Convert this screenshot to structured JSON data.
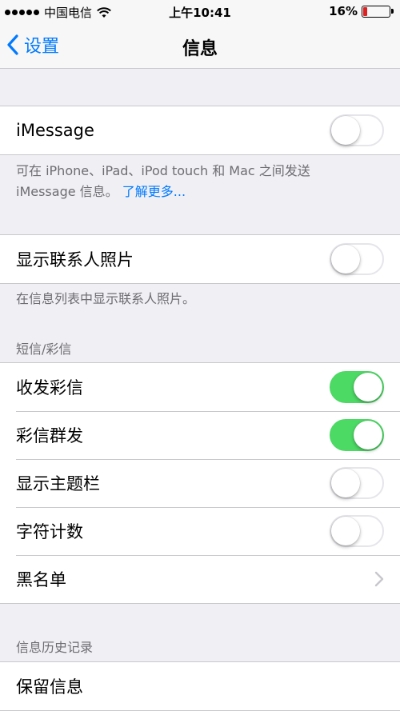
{
  "status_bar": {
    "carrier": "中国电信",
    "time": "上午10:41",
    "battery_percent": "16%",
    "battery_level": 0.16,
    "battery_color": "#e02020",
    "wifi_icon": "wifi-icon"
  },
  "nav": {
    "back_label": "设置",
    "back_icon": "chevron-left-icon",
    "title": "信息"
  },
  "imessage": {
    "label": "iMessage",
    "enabled": false,
    "footer_text": "可在 iPhone、iPad、iPod touch 和 Mac 之间发送 iMessage 信息。",
    "footer_link": "了解更多..."
  },
  "contact_photos": {
    "label": "显示联系人照片",
    "enabled": false,
    "footer_text": "在信息列表中显示联系人照片。"
  },
  "sms_mms": {
    "header": "短信/彩信",
    "items": [
      {
        "label": "收发彩信",
        "enabled": true
      },
      {
        "label": "彩信群发",
        "enabled": true
      },
      {
        "label": "显示主题栏",
        "enabled": false
      },
      {
        "label": "字符计数",
        "enabled": false
      },
      {
        "label": "黑名单",
        "chevron_icon": "chevron-right-icon"
      }
    ]
  },
  "history": {
    "header": "信息历史记录",
    "items": [
      {
        "label": "保留信息"
      }
    ]
  },
  "colors": {
    "accent": "#007aff",
    "toggle_on": "#4cd964",
    "background": "#efeff4"
  }
}
